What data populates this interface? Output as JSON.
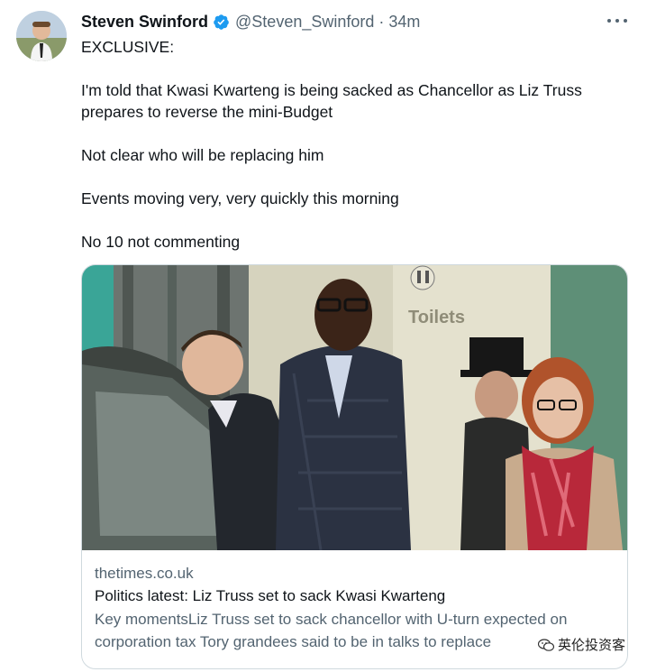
{
  "tweet": {
    "author": {
      "display_name": "Steven Swinford",
      "handle": "@Steven_Swinford",
      "verified": true,
      "avatar_icon": "user-avatar"
    },
    "separator": "·",
    "timestamp": "34m",
    "more_icon": "more-horizontal-icon",
    "paragraphs": [
      "EXCLUSIVE:",
      "I'm told that Kwasi Kwarteng is being sacked as Chancellor as Liz Truss prepares to reverse the mini-Budget",
      "Not clear who will be replacing him",
      "Events moving very, very quickly this morning",
      "No 10 not commenting"
    ],
    "card": {
      "domain": "thetimes.co.uk",
      "title": "Politics latest: Liz Truss set to sack Kwasi Kwarteng",
      "description": "Key momentsLiz Truss set to sack chancellor with U-turn expected on corporation tax Tory grandees said to be in talks to replace",
      "image": {
        "sign_text": "Toilets",
        "depicts": [
          "car",
          "man-in-dark-jacket",
          "man-in-quilted-jacket",
          "man-in-top-hat",
          "woman-with-red-scarf"
        ]
      }
    }
  },
  "watermark": {
    "text": "英伦投资客",
    "icon": "wechat-icon"
  },
  "colors": {
    "text_primary": "#0f1419",
    "text_secondary": "#536471",
    "verified_blue": "#1d9bf0",
    "card_border": "#cfd9de"
  }
}
